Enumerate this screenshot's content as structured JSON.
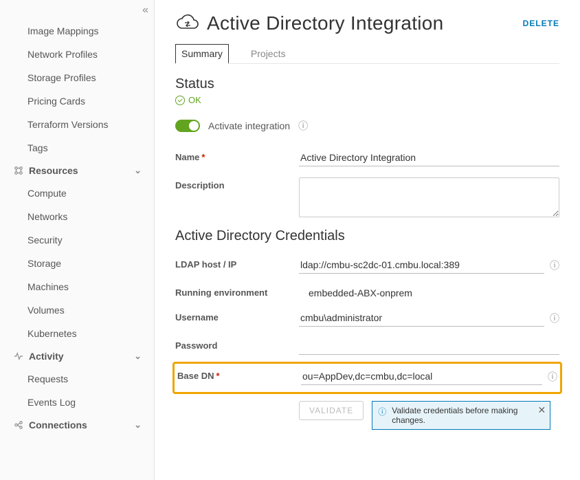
{
  "sidebar": {
    "plain_items_top": [
      "Image Mappings",
      "Network Profiles",
      "Storage Profiles",
      "Pricing Cards",
      "Terraform Versions",
      "Tags"
    ],
    "groups": [
      {
        "icon": "resources-icon",
        "label": "Resources",
        "items": [
          "Compute",
          "Networks",
          "Security",
          "Storage",
          "Machines",
          "Volumes",
          "Kubernetes"
        ]
      },
      {
        "icon": "activity-icon",
        "label": "Activity",
        "items": [
          "Requests",
          "Events Log"
        ]
      },
      {
        "icon": "connections-icon",
        "label": "Connections",
        "items": []
      }
    ]
  },
  "page": {
    "title": "Active Directory Integration",
    "delete_label": "DELETE",
    "tabs": {
      "summary": "Summary",
      "projects": "Projects"
    },
    "status_heading": "Status",
    "status_value": "OK",
    "activate_label": "Activate integration",
    "fields": {
      "name_label": "Name",
      "name_value": "Active Directory Integration",
      "description_label": "Description",
      "description_value": ""
    },
    "credentials_heading": "Active Directory Credentials",
    "credentials": {
      "ldap_label": "LDAP host / IP",
      "ldap_value": "ldap://cmbu-sc2dc-01.cmbu.local:389",
      "env_label": "Running environment",
      "env_value": "embedded-ABX-onprem",
      "user_label": "Username",
      "user_value": "cmbu\\administrator",
      "password_label": "Password",
      "password_value": "",
      "basedn_label": "Base DN",
      "basedn_value": "ou=AppDev,dc=cmbu,dc=local"
    },
    "validate_label": "VALIDATE",
    "info_banner": "Validate credentials before making changes."
  }
}
